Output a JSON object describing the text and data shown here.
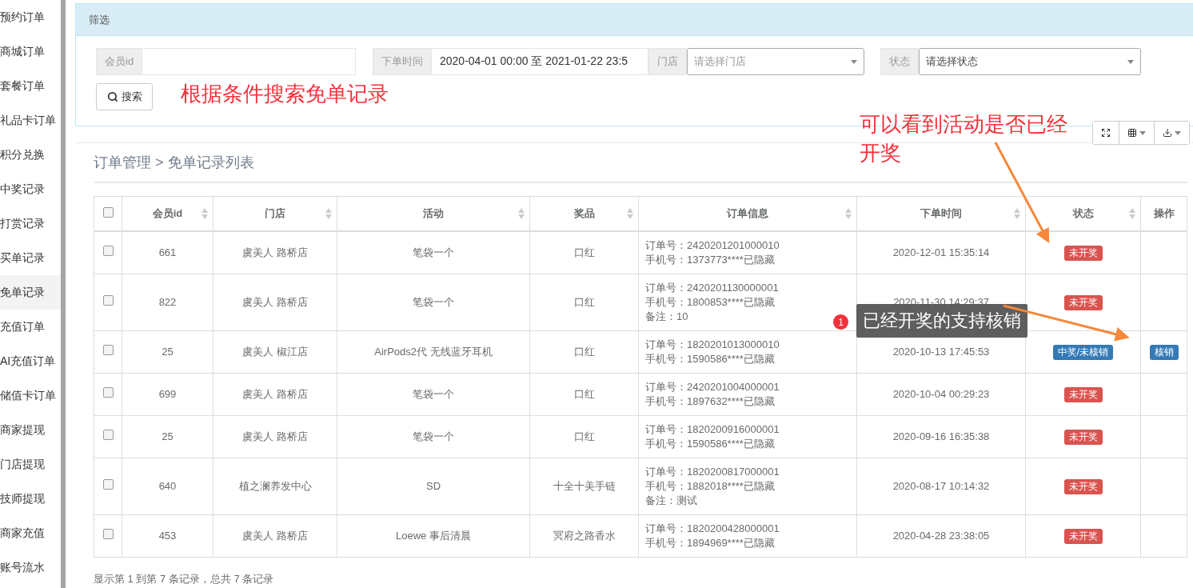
{
  "sidebar": {
    "items": [
      {
        "label": "预约订单",
        "selected": false
      },
      {
        "label": "商城订单",
        "selected": false
      },
      {
        "label": "套餐订单",
        "selected": false
      },
      {
        "label": "礼品卡订单",
        "selected": false
      },
      {
        "label": "积分兑换",
        "selected": false
      },
      {
        "label": "中奖记录",
        "selected": false
      },
      {
        "label": "打赏记录",
        "selected": false
      },
      {
        "label": "买单记录",
        "selected": false
      },
      {
        "label": "免单记录",
        "selected": true
      },
      {
        "label": "充值订单",
        "selected": false
      },
      {
        "label": "AI充值订单",
        "selected": false
      },
      {
        "label": "储值卡订单",
        "selected": false
      },
      {
        "label": "商家提现",
        "selected": false
      },
      {
        "label": "门店提现",
        "selected": false
      },
      {
        "label": "技师提现",
        "selected": false
      },
      {
        "label": "商家充值",
        "selected": false
      },
      {
        "label": "账号流水",
        "selected": false
      }
    ]
  },
  "filter": {
    "title": "筛选",
    "fields": [
      {
        "label": "会员id",
        "kind": "text"
      },
      {
        "label": "下单时间",
        "kind": "date",
        "value": "2020-04-01 00:00 至 2021-01-22 23:5"
      },
      {
        "label": "门店",
        "kind": "select",
        "placeholder": "请选择门店"
      },
      {
        "label": "状态",
        "kind": "select",
        "value": "请选择状态"
      }
    ],
    "search_button": "搜索"
  },
  "breadcrumb": "订单管理 > 免单记录列表",
  "table": {
    "header_checked": false,
    "columns": [
      {
        "label": "会员id",
        "sortable": true
      },
      {
        "label": "门店",
        "sortable": true
      },
      {
        "label": "活动",
        "sortable": true
      },
      {
        "label": "奖品",
        "sortable": true
      },
      {
        "label": "订单信息",
        "sortable": true
      },
      {
        "label": "下单时间",
        "sortable": true
      },
      {
        "label": "状态",
        "sortable": true
      },
      {
        "label": "操作",
        "sortable": false
      }
    ],
    "rows": [
      {
        "checked": false,
        "member_id": "661",
        "store": "虞美人 路桥店",
        "activity": "笔袋一个",
        "prize": "口红",
        "order_info": [
          "订单号：2420201201000010",
          "手机号：1373773****已隐藏"
        ],
        "time": "2020-12-01 15:35:14",
        "status": {
          "label": "未开奖",
          "kind": "pending"
        }
      },
      {
        "checked": false,
        "member_id": "822",
        "store": "虞美人 路桥店",
        "activity": "笔袋一个",
        "prize": "口红",
        "order_info": [
          "订单号：2420201130000001",
          "手机号：1800853****已隐藏",
          "备注：10"
        ],
        "time": "2020-11-30 14:29:37",
        "status": {
          "label": "未开奖",
          "kind": "pending"
        }
      },
      {
        "checked": false,
        "member_id": "25",
        "store": "虞美人 椒江店",
        "activity": "AirPods2代 无线蓝牙耳机",
        "prize": "口红",
        "order_info": [
          "订单号：1820201013000010",
          "手机号：1590586****已隐藏"
        ],
        "time": "2020-10-13 17:45:53",
        "status": {
          "label": "中奖/未核销",
          "kind": "won"
        },
        "action": "核销"
      },
      {
        "checked": false,
        "member_id": "699",
        "store": "虞美人 路桥店",
        "activity": "笔袋一个",
        "prize": "口红",
        "order_info": [
          "订单号：2420201004000001",
          "手机号：1897632****已隐藏"
        ],
        "time": "2020-10-04 00:29:23",
        "status": {
          "label": "未开奖",
          "kind": "pending"
        }
      },
      {
        "checked": false,
        "member_id": "25",
        "store": "虞美人 路桥店",
        "activity": "笔袋一个",
        "prize": "口红",
        "order_info": [
          "订单号：1820200916000001",
          "手机号：1590586****已隐藏"
        ],
        "time": "2020-09-16 16:35:38",
        "status": {
          "label": "未开奖",
          "kind": "pending"
        }
      },
      {
        "checked": false,
        "member_id": "640",
        "store": "植之澜养发中心",
        "activity": "SD",
        "prize": "十全十美手链",
        "order_info": [
          "订单号：1820200817000001",
          "手机号：1882018****已隐藏",
          "备注：测试"
        ],
        "time": "2020-08-17 10:14:32",
        "status": {
          "label": "未开奖",
          "kind": "pending"
        }
      },
      {
        "checked": false,
        "member_id": "453",
        "store": "虞美人 路桥店",
        "activity": "Loewe 事后清晨",
        "prize": "冥府之路香水",
        "order_info": [
          "订单号：1820200428000001",
          "手机号：1894969****已隐藏"
        ],
        "time": "2020-04-28 23:38:05",
        "status": {
          "label": "未开奖",
          "kind": "pending"
        }
      }
    ]
  },
  "pagination_info": "显示第 1 到第 7 条记录，总共 7 条记录",
  "annotations": [
    {
      "kind": "note",
      "text": "根据条件搜索免单记录"
    },
    {
      "kind": "note",
      "text": "可以看到活动是否已经开奖"
    },
    {
      "kind": "callout",
      "badge": "1",
      "text": "已经开奖的支持核销"
    }
  ]
}
